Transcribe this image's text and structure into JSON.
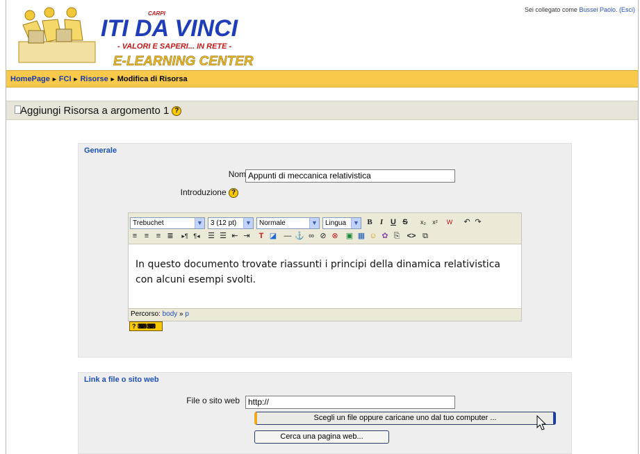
{
  "header": {
    "logo_school": "ITI DA VINCI",
    "logo_city": "CARPI",
    "logo_tagline": "- VALORI E SAPERI... IN RETE -",
    "logo_subtitle": "E-LEARNING CENTER",
    "login_prefix": "Sei collegato come",
    "login_user": "Bussei Paolo",
    "logout_label": "(Esci)"
  },
  "breadcrumb": {
    "items": [
      "HomePage",
      "FCI",
      "Risorse"
    ],
    "current": "Modifica di Risorsa"
  },
  "heading": {
    "title": "Aggiungi Risorsa a argomento 1"
  },
  "generale": {
    "legend": "Generale",
    "name_label": "Nome",
    "name_required": "*",
    "name_value": "Appunti di meccanica relativistica",
    "intro_label": "Introduzione"
  },
  "editor": {
    "font": "Trebuchet",
    "size": "3 (12 pt)",
    "style": "Normale",
    "language": "Lingua",
    "content_line1": "In questo documento trovate riassunti i principi della dinamica relativistica",
    "content_line2": "con alcuni esempi svolti.",
    "path_label": "Percorso:",
    "path_body": "body",
    "path_sep": "»",
    "path_p": "p"
  },
  "link": {
    "legend": "Link a file o sito web",
    "file_label": "File o sito web",
    "file_value": "http://",
    "choose_button": "Scegli un file oppure caricane uno dal tuo computer ...",
    "search_button": "Cerca una pagina web..."
  },
  "colors": {
    "navbar": "#f8c94a",
    "link": "#1c4fb8",
    "fieldset_bg": "#eeeeee"
  }
}
